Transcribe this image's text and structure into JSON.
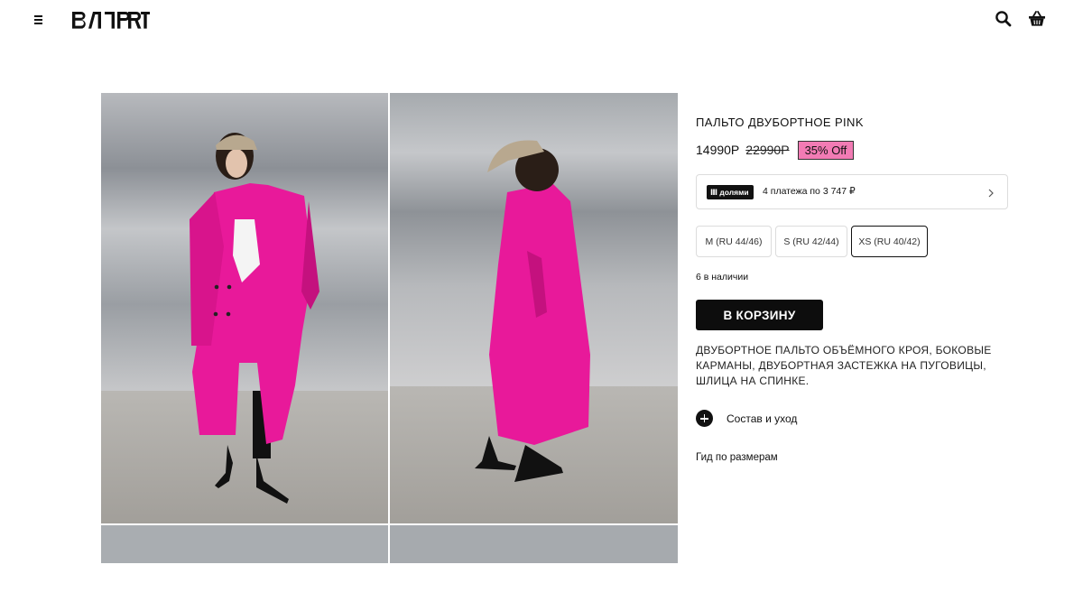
{
  "header": {
    "menu_icon": "hamburger-icon",
    "logo_text": "ВЛРRT",
    "search_icon": "search-icon",
    "cart_icon": "basket-icon"
  },
  "gallery": {
    "photos": [
      {
        "subject": "model-front"
      },
      {
        "subject": "model-side"
      },
      {
        "subject": "model-closeup"
      },
      {
        "subject": "model-closeup"
      }
    ],
    "colors": {
      "coat": "#e8199a",
      "wall": "#9b9fa5",
      "floor": "#aaa7a3"
    }
  },
  "product": {
    "title": "ПАЛЬТО ДВУБОРТНОЕ PINK",
    "price_current": "14990Р",
    "price_old": "22990Р",
    "discount": "35% Off",
    "discount_color": "#f27bb4",
    "installments": {
      "badge": "Ⅲ долями",
      "text": "4 платежа по 3 747 ₽",
      "chevron_icon": "chevron-right-icon"
    },
    "sizes": [
      {
        "label": "M (RU 44/46)",
        "selected": false
      },
      {
        "label": "S (RU 42/44)",
        "selected": false
      },
      {
        "label": "XS (RU 40/42)",
        "selected": true
      }
    ],
    "stock": "6 в наличии",
    "add_to_cart": "В КОРЗИНУ",
    "description": "ДВУБОРТНОЕ ПАЛЬТО ОБЪЁМНОГО КРОЯ, БОКОВЫЕ КАРМАНЫ, ДВУБОРТНАЯ ЗАСТЕЖКА НА ПУГОВИЦЫ, ШЛИЦА НА СПИНКЕ.",
    "composition_label": "Состав и уход",
    "size_guide": "Гид по размерам"
  }
}
